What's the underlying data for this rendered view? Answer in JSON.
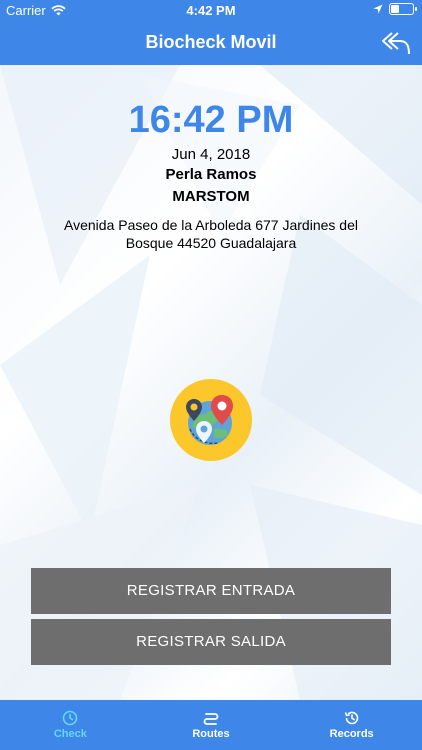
{
  "status_bar": {
    "carrier": "Carrier",
    "time": "4:42 PM"
  },
  "header": {
    "title": "Biocheck Movil"
  },
  "check": {
    "clock": "16:42 PM",
    "date": "Jun 4, 2018",
    "name": "Perla Ramos",
    "company": "MARSTOM",
    "address": "Avenida Paseo de la Arboleda 677 Jardines del Bosque 44520 Guadalajara"
  },
  "buttons": {
    "check_in": "REGISTRAR ENTRADA",
    "check_out": "REGISTRAR SALIDA"
  },
  "tabs": [
    {
      "label": "Check",
      "icon": "clock-icon",
      "active": true
    },
    {
      "label": "Routes",
      "icon": "routes-icon",
      "active": false
    },
    {
      "label": "Records",
      "icon": "history-icon",
      "active": false
    }
  ],
  "colors": {
    "primary": "#3e86e8",
    "active_tab": "#64d8f7",
    "button": "#6e6e6e"
  }
}
